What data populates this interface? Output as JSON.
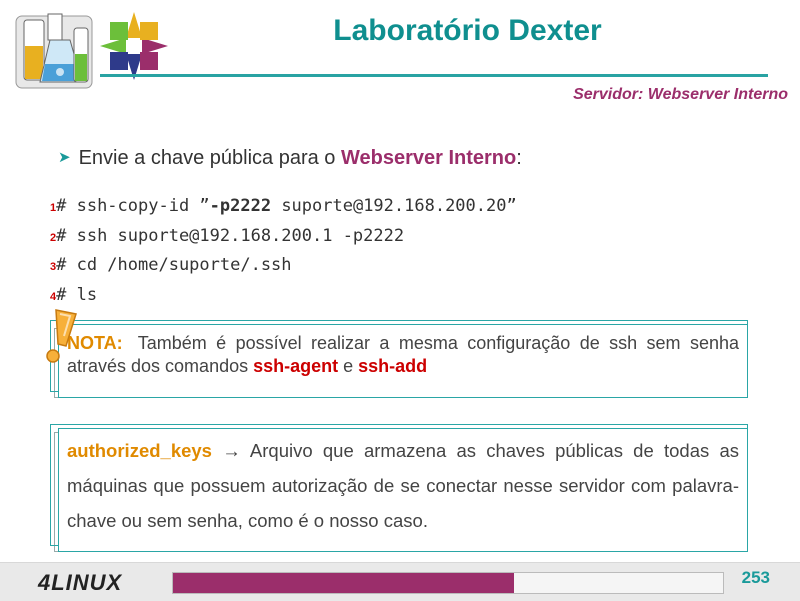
{
  "header": {
    "title": "Laboratório Dexter",
    "subtitle": "Servidor: Webserver Interno"
  },
  "bullet": {
    "text_before": "Envie a chave pública para o ",
    "highlight": "Webserver Interno",
    "text_after": ":"
  },
  "code_lines": [
    {
      "num": "1",
      "parts": [
        "# ssh-copy-id ”",
        "-p2222",
        " suporte@192.168.200.20”"
      ]
    },
    {
      "num": "2",
      "text": "# ssh suporte@192.168.200.1 -p2222"
    },
    {
      "num": "3",
      "text": "# cd /home/suporte/.ssh"
    },
    {
      "num": "4",
      "text": "# ls"
    }
  ],
  "nota": {
    "label": "NOTA:",
    "text_before": "Também é possível realizar a mesma configuração de ssh sem senha através dos comandos ",
    "cmd1": "ssh-agent",
    "mid": " e ",
    "cmd2": "ssh-add"
  },
  "authorized": {
    "label": "authorized_keys",
    "text": " → Arquivo que armazena as chaves públicas de todas as máquinas que possuem autorização de se conectar nesse servidor com palavra-chave ou sem senha, como é o nosso caso."
  },
  "footer": {
    "logo": "4LINUX",
    "page_number": "253",
    "progress": 0.62
  },
  "colors": {
    "accent": "#0f8f8f",
    "brand": "#9b2e6b",
    "label": "#e08a00",
    "command": "#cc0000"
  },
  "icons": [
    "lab-flasks-icon",
    "centos-star-icon",
    "warning-exclamation-icon",
    "bullet-arrow-icon"
  ]
}
